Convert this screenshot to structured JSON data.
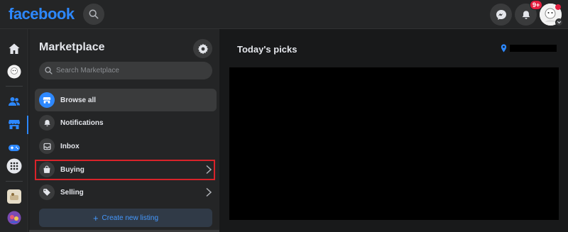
{
  "topbar": {
    "logo": "facebook",
    "notifications_badge": "9+",
    "icons": [
      "search-icon",
      "messenger-icon",
      "bell-icon",
      "avatar",
      "chevron-down-icon"
    ]
  },
  "rail": {
    "items": [
      "home-icon",
      "profile-avatar",
      "friends-icon",
      "marketplace-icon",
      "gaming-icon",
      "menu-grid-icon",
      "shortcut-avatar-1",
      "shortcut-avatar-2"
    ]
  },
  "sidebar": {
    "title": "Marketplace",
    "search_placeholder": "Search Marketplace",
    "items": [
      {
        "label": "Browse all",
        "icon": "storefront-icon"
      },
      {
        "label": "Notifications",
        "icon": "bell-icon"
      },
      {
        "label": "Inbox",
        "icon": "inbox-icon"
      },
      {
        "label": "Buying",
        "icon": "shopping-bag-icon"
      },
      {
        "label": "Selling",
        "icon": "tag-icon"
      }
    ],
    "create_label": "Create new listing"
  },
  "main": {
    "title": "Today's picks"
  },
  "colors": {
    "accent": "#2d88ff",
    "highlight": "#d8232a",
    "background": "#18191a",
    "surface": "#242526"
  }
}
